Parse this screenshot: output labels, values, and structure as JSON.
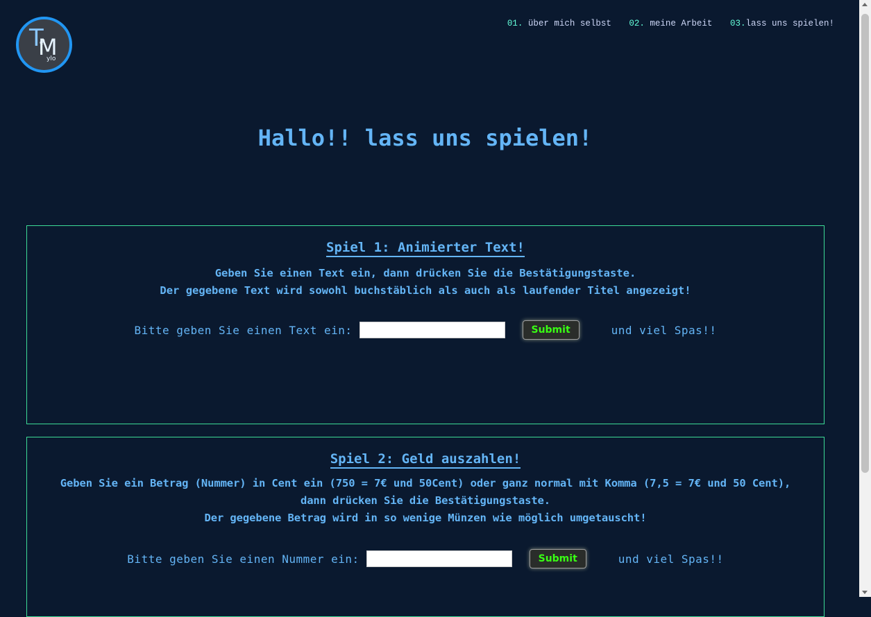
{
  "logo": {
    "big_t": "T",
    "big_m": "M",
    "small_top": "el",
    "small_bottom": "ylo"
  },
  "nav": [
    {
      "num": "01.",
      "label": "über mich selbst"
    },
    {
      "num": "02.",
      "label": "meine Arbeit"
    },
    {
      "num": "03.",
      "label": "lass uns spielen!"
    }
  ],
  "hero": {
    "title": "Hallo!! lass uns spielen!"
  },
  "game1": {
    "title": "Spiel 1: Animierter Text!",
    "desc_line1": "Geben Sie einen Text ein, dann drücken Sie die Bestätigungstaste.",
    "desc_line2": "Der gegebene Text wird sowohl buchstäblich als auch als laufender Titel angezeigt!",
    "prompt": "Bitte geben Sie einen Text ein:",
    "input_value": "",
    "submit": "Submit",
    "suffix": "und viel Spas!!"
  },
  "game2": {
    "title": "Spiel 2: Geld auszahlen!",
    "desc_line1": "Geben Sie ein Betrag (Nummer) in Cent ein (750 = 7€ und 50Cent) oder ganz normal mit Komma (7,5 = 7€ und 50 Cent),",
    "desc_line2": "dann drücken Sie die Bestätigungstaste.",
    "desc_line3": "Der gegebene Betrag wird in so wenige Münzen wie möglich umgetauscht!",
    "prompt": "Bitte geben Sie einen Nummer ein:",
    "input_value": "",
    "submit": "Submit",
    "suffix": "und viel Spas!!"
  }
}
